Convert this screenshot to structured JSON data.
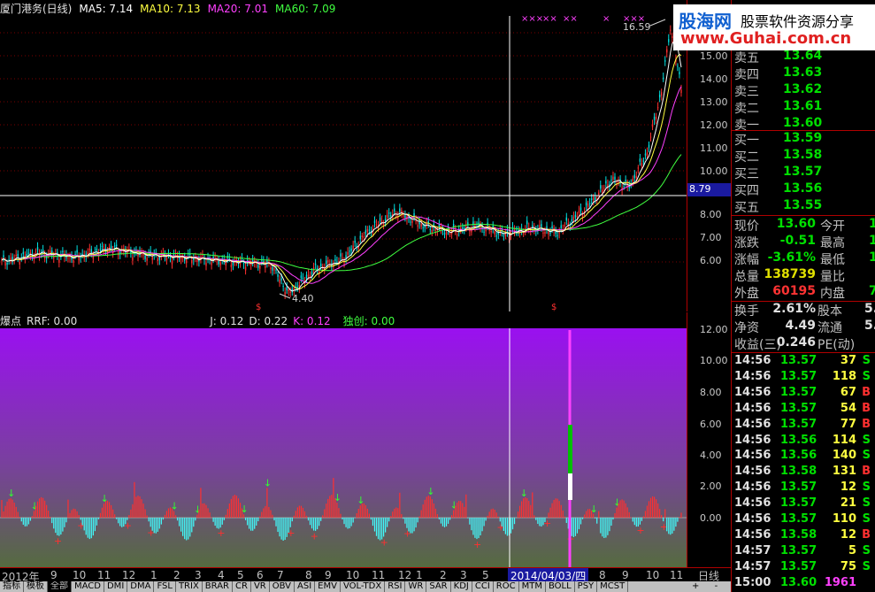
{
  "stock": {
    "title": "厦门港务(日线)",
    "ma5": "MA5: 7.14",
    "ma10": "MA10: 7.13",
    "ma20": "MA20: 7.01",
    "ma60": "MA60: 7.09"
  },
  "markers": {
    "high": "16.59",
    "low": "4.40",
    "cursor_price": "8.79"
  },
  "price_axis": [
    "15.00",
    "14.00",
    "13.00",
    "12.00",
    "11.00",
    "10.00",
    "8.00",
    "7.00",
    "6.00"
  ],
  "indicator": {
    "name": "爆点",
    "rrf": "RRF: 0.00",
    "j": "J: 0.12",
    "d": "D: 0.22",
    "k": "K: 0.12",
    "duchuang": "独创: 0.00"
  },
  "ind_axis": [
    "12.00",
    "10.00",
    "8.00",
    "6.00",
    "4.00",
    "2.00",
    "0.00"
  ],
  "dates": [
    "2012年",
    "9",
    "10",
    "11",
    "12",
    "1",
    "2",
    "3",
    "4",
    "5",
    "6",
    "7",
    "8",
    "9",
    "10",
    "11",
    "12",
    "1",
    "2",
    "3",
    "5",
    "6",
    "7",
    "8",
    "9",
    "10",
    "11"
  ],
  "cursor_date": "2014/04/03/四",
  "period": "日线",
  "tabs": [
    "指标",
    "模板",
    "全部",
    "MACD",
    "DMI",
    "DMA",
    "FSL",
    "TRIX",
    "BRAR",
    "CR",
    "VR",
    "OBV",
    "ASI",
    "EMV",
    "VOL-TDX",
    "RSI",
    "WR",
    "SAR",
    "KDJ",
    "CCI",
    "ROC",
    "MTM",
    "BOLL",
    "PSY",
    "MCST"
  ],
  "nav": [
    "+",
    "-"
  ],
  "banner": {
    "logo": "股海网",
    "slogan": "股票软件资源分享",
    "url": "www.Guhai.com.cn"
  },
  "orderbook": {
    "asks": [
      {
        "label": "卖五",
        "price": "13.64"
      },
      {
        "label": "卖四",
        "price": "13.63"
      },
      {
        "label": "卖三",
        "price": "13.62"
      },
      {
        "label": "卖二",
        "price": "13.61"
      },
      {
        "label": "卖一",
        "price": "13.60"
      }
    ],
    "bids": [
      {
        "label": "买一",
        "price": "13.59"
      },
      {
        "label": "买二",
        "price": "13.58"
      },
      {
        "label": "买三",
        "price": "13.57"
      },
      {
        "label": "买四",
        "price": "13.56"
      },
      {
        "label": "买五",
        "price": "13.55"
      }
    ]
  },
  "quote": [
    {
      "l1": "现价",
      "v1": "13.60",
      "l2": "今开",
      "v2": "1"
    },
    {
      "l1": "涨跌",
      "v1": "-0.51",
      "l2": "最高",
      "v2": "1"
    },
    {
      "l1": "涨幅",
      "v1": "-3.61%",
      "l2": "最低",
      "v2": "1"
    },
    {
      "l1": "总量",
      "v1": "138739",
      "l2": "量比",
      "v2": ""
    },
    {
      "l1": "外盘",
      "v1": "60195",
      "l2": "内盘",
      "v2": "7"
    }
  ],
  "finance": [
    {
      "l1": "换手",
      "v1": "2.61%",
      "l2": "股本",
      "v2": "5."
    },
    {
      "l1": "净资",
      "v1": "4.49",
      "l2": "流通",
      "v2": "5."
    },
    {
      "l1": "收益(三)",
      "v1": "0.246",
      "l2": "PE(动)",
      "v2": ""
    }
  ],
  "ticks": [
    {
      "t": "14:56",
      "p": "13.57",
      "v": "37",
      "s": "S"
    },
    {
      "t": "14:56",
      "p": "13.57",
      "v": "118",
      "s": "S"
    },
    {
      "t": "14:56",
      "p": "13.57",
      "v": "67",
      "s": "B"
    },
    {
      "t": "14:56",
      "p": "13.57",
      "v": "54",
      "s": "B"
    },
    {
      "t": "14:56",
      "p": "13.57",
      "v": "77",
      "s": "B"
    },
    {
      "t": "14:56",
      "p": "13.56",
      "v": "114",
      "s": "S"
    },
    {
      "t": "14:56",
      "p": "13.56",
      "v": "140",
      "s": "S"
    },
    {
      "t": "14:56",
      "p": "13.58",
      "v": "131",
      "s": "B"
    },
    {
      "t": "14:56",
      "p": "13.57",
      "v": "12",
      "s": "S"
    },
    {
      "t": "14:56",
      "p": "13.57",
      "v": "21",
      "s": "S"
    },
    {
      "t": "14:56",
      "p": "13.57",
      "v": "110",
      "s": "S"
    },
    {
      "t": "14:56",
      "p": "13.58",
      "v": "12",
      "s": "B"
    },
    {
      "t": "14:57",
      "p": "13.57",
      "v": "5",
      "s": "S"
    },
    {
      "t": "14:57",
      "p": "13.57",
      "v": "75",
      "s": "S"
    },
    {
      "t": "15:00",
      "p": "13.60",
      "v": "1961",
      "s": ""
    }
  ]
}
